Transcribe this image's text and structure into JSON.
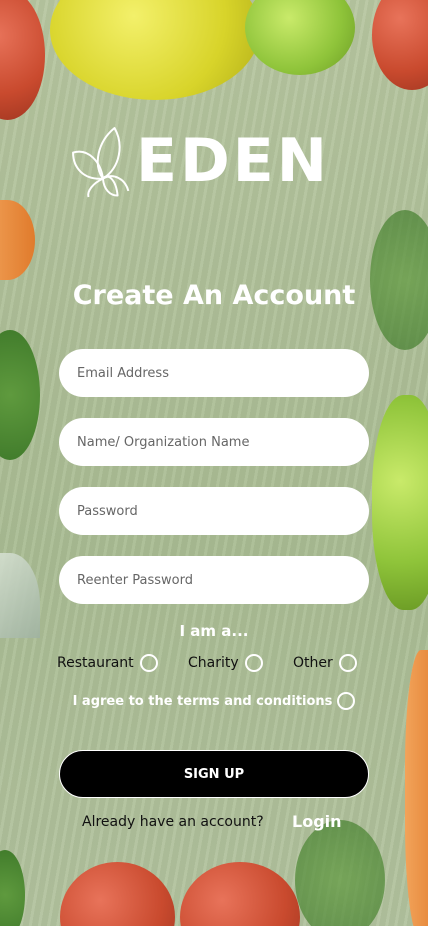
{
  "brand": {
    "name": "EDEN",
    "logo_icon": "leaf-petals-icon"
  },
  "title": "Create An Account",
  "form": {
    "email_placeholder": "Email Address",
    "name_placeholder": "Name/ Organization Name",
    "password_placeholder": "Password",
    "reenter_password_placeholder": "Reenter Password"
  },
  "role": {
    "prompt": "I am a...",
    "options": [
      "Restaurant",
      "Charity",
      "Other"
    ]
  },
  "terms_label": "I agree to the terms and conditions",
  "signup_label": "SIGN UP",
  "footer": {
    "prompt": "Already have an account?",
    "login_label": "Login"
  },
  "colors": {
    "overlay": "#aebf98",
    "field_bg": "#ffffff",
    "button_bg": "#000000",
    "text_light": "#ffffff"
  }
}
